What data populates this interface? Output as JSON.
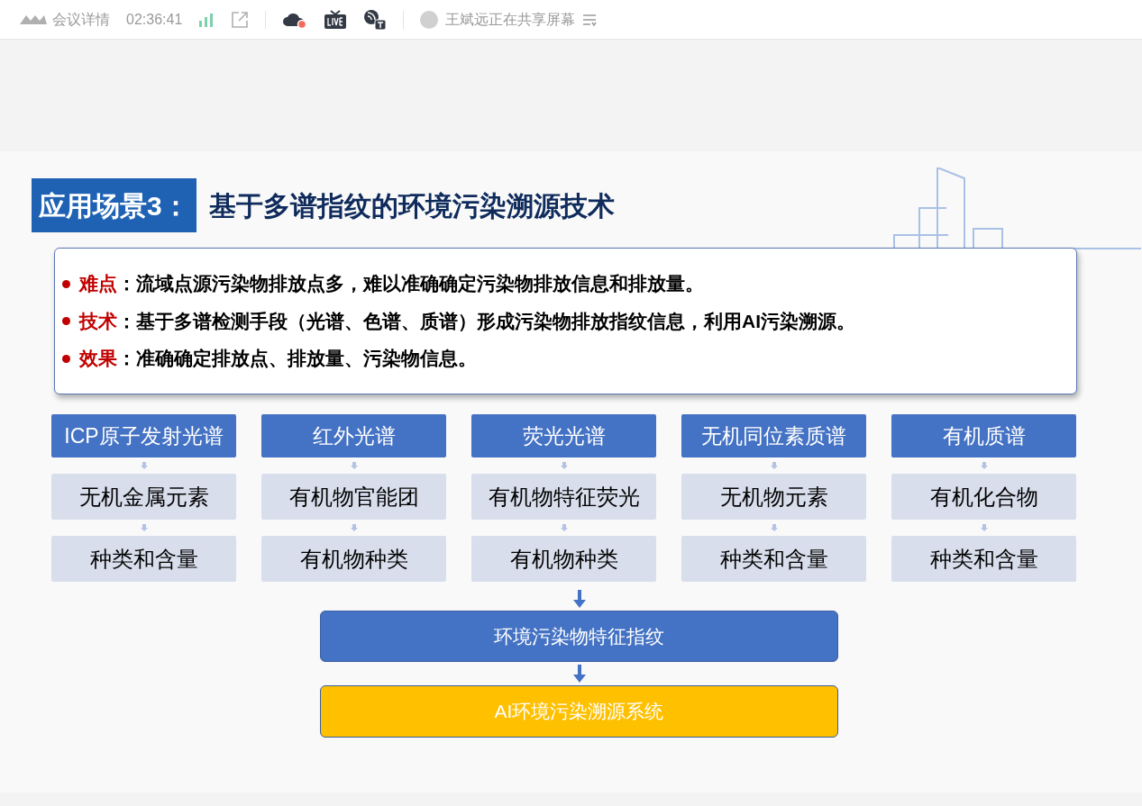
{
  "toolbar": {
    "title": "会议详情",
    "timer": "02:36:41",
    "sharing_status": "王斌远正在共享屏幕"
  },
  "slide": {
    "title_label": "应用场景3：",
    "title": "基于多谱指纹的环境污染溯源技术",
    "points": [
      {
        "label": "难点",
        "text": "：流域点源污染物排放点多，难以准确确定污染物排放信息和排放量。"
      },
      {
        "label": "技术",
        "text": "：基于多谱检测手段（光谱、色谱、质谱）形成污染物排放指纹信息，利用AI污染溯源。"
      },
      {
        "label": "效果",
        "text": "：准确确定排放点、排放量、污染物信息。"
      }
    ],
    "columns": [
      {
        "method": "ICP原子发射光谱",
        "items": [
          "无机金属元素",
          "种类和含量"
        ]
      },
      {
        "method": "红外光谱",
        "items": [
          "有机物官能团",
          "有机物种类"
        ]
      },
      {
        "method": "荧光光谱",
        "items": [
          "有机物特征荧光",
          "有机物种类"
        ]
      },
      {
        "method": "无机同位素质谱",
        "items": [
          "无机物元素",
          "种类和含量"
        ]
      },
      {
        "method": "有机质谱",
        "items": [
          "有机化合物",
          "种类和含量"
        ]
      }
    ],
    "fingerprint": "环境污染物特征指纹",
    "system": "AI环境污染溯源系统"
  }
}
